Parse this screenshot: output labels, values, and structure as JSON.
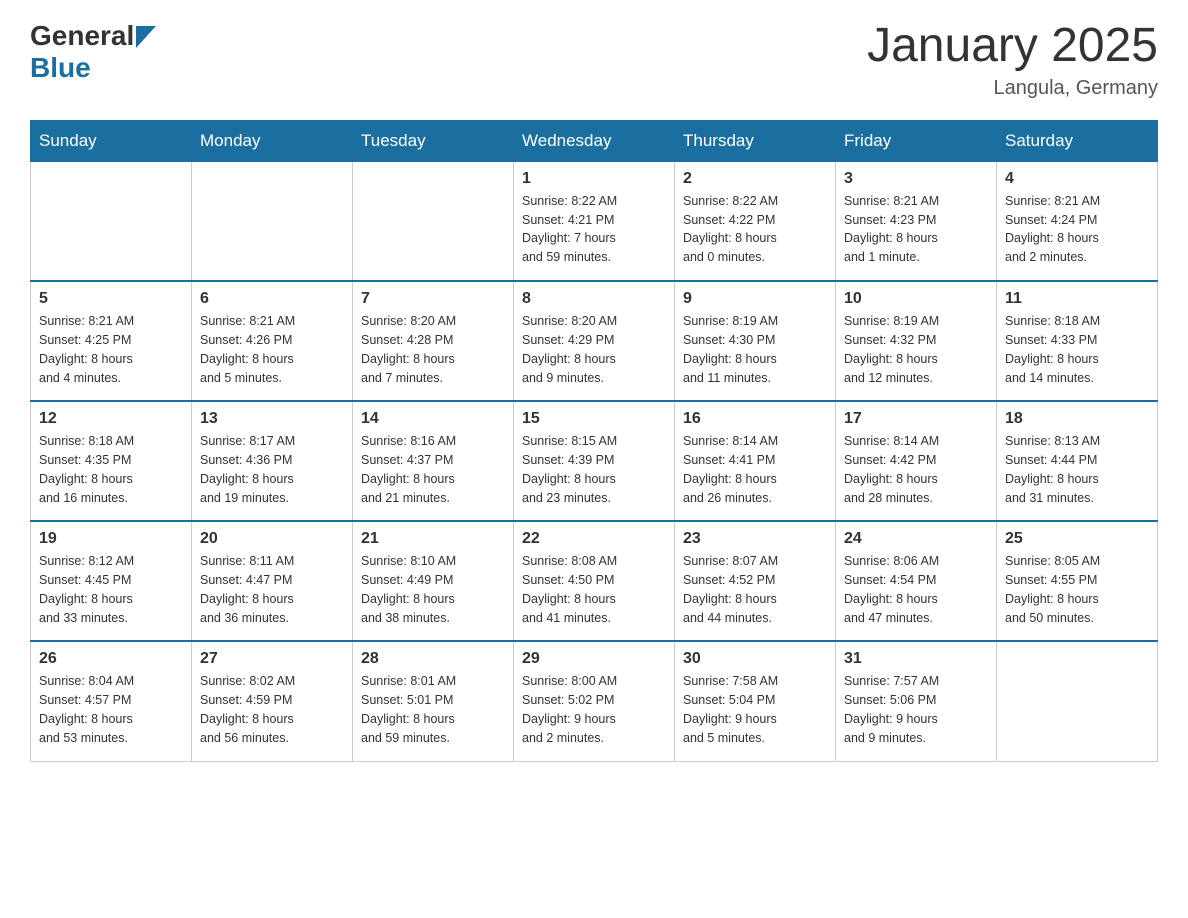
{
  "header": {
    "logo_general": "General",
    "logo_blue": "Blue",
    "title": "January 2025",
    "subtitle": "Langula, Germany"
  },
  "days_of_week": [
    "Sunday",
    "Monday",
    "Tuesday",
    "Wednesday",
    "Thursday",
    "Friday",
    "Saturday"
  ],
  "weeks": [
    [
      {
        "day": "",
        "info": ""
      },
      {
        "day": "",
        "info": ""
      },
      {
        "day": "",
        "info": ""
      },
      {
        "day": "1",
        "info": "Sunrise: 8:22 AM\nSunset: 4:21 PM\nDaylight: 7 hours\nand 59 minutes."
      },
      {
        "day": "2",
        "info": "Sunrise: 8:22 AM\nSunset: 4:22 PM\nDaylight: 8 hours\nand 0 minutes."
      },
      {
        "day": "3",
        "info": "Sunrise: 8:21 AM\nSunset: 4:23 PM\nDaylight: 8 hours\nand 1 minute."
      },
      {
        "day": "4",
        "info": "Sunrise: 8:21 AM\nSunset: 4:24 PM\nDaylight: 8 hours\nand 2 minutes."
      }
    ],
    [
      {
        "day": "5",
        "info": "Sunrise: 8:21 AM\nSunset: 4:25 PM\nDaylight: 8 hours\nand 4 minutes."
      },
      {
        "day": "6",
        "info": "Sunrise: 8:21 AM\nSunset: 4:26 PM\nDaylight: 8 hours\nand 5 minutes."
      },
      {
        "day": "7",
        "info": "Sunrise: 8:20 AM\nSunset: 4:28 PM\nDaylight: 8 hours\nand 7 minutes."
      },
      {
        "day": "8",
        "info": "Sunrise: 8:20 AM\nSunset: 4:29 PM\nDaylight: 8 hours\nand 9 minutes."
      },
      {
        "day": "9",
        "info": "Sunrise: 8:19 AM\nSunset: 4:30 PM\nDaylight: 8 hours\nand 11 minutes."
      },
      {
        "day": "10",
        "info": "Sunrise: 8:19 AM\nSunset: 4:32 PM\nDaylight: 8 hours\nand 12 minutes."
      },
      {
        "day": "11",
        "info": "Sunrise: 8:18 AM\nSunset: 4:33 PM\nDaylight: 8 hours\nand 14 minutes."
      }
    ],
    [
      {
        "day": "12",
        "info": "Sunrise: 8:18 AM\nSunset: 4:35 PM\nDaylight: 8 hours\nand 16 minutes."
      },
      {
        "day": "13",
        "info": "Sunrise: 8:17 AM\nSunset: 4:36 PM\nDaylight: 8 hours\nand 19 minutes."
      },
      {
        "day": "14",
        "info": "Sunrise: 8:16 AM\nSunset: 4:37 PM\nDaylight: 8 hours\nand 21 minutes."
      },
      {
        "day": "15",
        "info": "Sunrise: 8:15 AM\nSunset: 4:39 PM\nDaylight: 8 hours\nand 23 minutes."
      },
      {
        "day": "16",
        "info": "Sunrise: 8:14 AM\nSunset: 4:41 PM\nDaylight: 8 hours\nand 26 minutes."
      },
      {
        "day": "17",
        "info": "Sunrise: 8:14 AM\nSunset: 4:42 PM\nDaylight: 8 hours\nand 28 minutes."
      },
      {
        "day": "18",
        "info": "Sunrise: 8:13 AM\nSunset: 4:44 PM\nDaylight: 8 hours\nand 31 minutes."
      }
    ],
    [
      {
        "day": "19",
        "info": "Sunrise: 8:12 AM\nSunset: 4:45 PM\nDaylight: 8 hours\nand 33 minutes."
      },
      {
        "day": "20",
        "info": "Sunrise: 8:11 AM\nSunset: 4:47 PM\nDaylight: 8 hours\nand 36 minutes."
      },
      {
        "day": "21",
        "info": "Sunrise: 8:10 AM\nSunset: 4:49 PM\nDaylight: 8 hours\nand 38 minutes."
      },
      {
        "day": "22",
        "info": "Sunrise: 8:08 AM\nSunset: 4:50 PM\nDaylight: 8 hours\nand 41 minutes."
      },
      {
        "day": "23",
        "info": "Sunrise: 8:07 AM\nSunset: 4:52 PM\nDaylight: 8 hours\nand 44 minutes."
      },
      {
        "day": "24",
        "info": "Sunrise: 8:06 AM\nSunset: 4:54 PM\nDaylight: 8 hours\nand 47 minutes."
      },
      {
        "day": "25",
        "info": "Sunrise: 8:05 AM\nSunset: 4:55 PM\nDaylight: 8 hours\nand 50 minutes."
      }
    ],
    [
      {
        "day": "26",
        "info": "Sunrise: 8:04 AM\nSunset: 4:57 PM\nDaylight: 8 hours\nand 53 minutes."
      },
      {
        "day": "27",
        "info": "Sunrise: 8:02 AM\nSunset: 4:59 PM\nDaylight: 8 hours\nand 56 minutes."
      },
      {
        "day": "28",
        "info": "Sunrise: 8:01 AM\nSunset: 5:01 PM\nDaylight: 8 hours\nand 59 minutes."
      },
      {
        "day": "29",
        "info": "Sunrise: 8:00 AM\nSunset: 5:02 PM\nDaylight: 9 hours\nand 2 minutes."
      },
      {
        "day": "30",
        "info": "Sunrise: 7:58 AM\nSunset: 5:04 PM\nDaylight: 9 hours\nand 5 minutes."
      },
      {
        "day": "31",
        "info": "Sunrise: 7:57 AM\nSunset: 5:06 PM\nDaylight: 9 hours\nand 9 minutes."
      },
      {
        "day": "",
        "info": ""
      }
    ]
  ]
}
